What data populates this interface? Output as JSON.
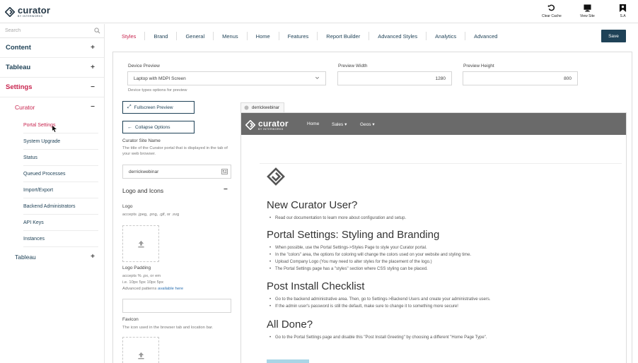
{
  "header": {
    "brand_name": "curator",
    "brand_sub": "BY INTERWORKS",
    "actions": [
      {
        "label": "Clear Cache",
        "icon": "refresh-icon"
      },
      {
        "label": "View Site",
        "icon": "monitor-icon"
      },
      {
        "label": "S.A",
        "icon": "user-flag-icon"
      }
    ]
  },
  "sidebar": {
    "search_placeholder": "Search",
    "items": [
      {
        "label": "Content",
        "toggle": "+"
      },
      {
        "label": "Tableau",
        "toggle": "+"
      },
      {
        "label": "Settings",
        "toggle": "−"
      }
    ],
    "curator": {
      "label": "Curator",
      "toggle": "−"
    },
    "leaves": [
      "Portal Settings",
      "System Upgrade",
      "Status",
      "Queued Processes",
      "Import/Export",
      "Backend Administrators",
      "API Keys",
      "Instances"
    ],
    "tableau_sub": {
      "label": "Tableau",
      "toggle": "+"
    }
  },
  "tabs": [
    "Styles",
    "Brand",
    "General",
    "Menus",
    "Home",
    "Features",
    "Report Builder",
    "Advanced Styles",
    "Analytics",
    "Advanced"
  ],
  "save_label": "Save",
  "form": {
    "device_preview_label": "Device Preview",
    "device_preview_value": "Laptop with MDPI Screen",
    "device_preview_hint": "Device types options for preview",
    "preview_width_label": "Preview Width",
    "preview_width_value": "1280",
    "preview_height_label": "Preview Height",
    "preview_height_value": "800",
    "fullscreen_label": "Fullscreen Preview",
    "collapse_label": "Collapse Options",
    "site_name_label": "Curator Site Name",
    "site_name_hint": "The title of the Curator portal that is displayed in the tab of your web browser.",
    "site_name_value": "derrickwebinar",
    "logo_section": "Logo and Icons",
    "logo_section_toggle": "−",
    "logo_label": "Logo",
    "logo_hint": "accepts .jpeg, .png, .gif, or .svg",
    "logo_padding_label": "Logo Padding",
    "logo_padding_hint_1": "accepts % ,px, or em",
    "logo_padding_hint_2": "i.e. 10px 5px 10px 5px",
    "logo_padding_hint_3": "Advanced patterns",
    "logo_padding_link": "available here",
    "favicon_label": "Favicon",
    "favicon_hint": "The icon used in the browser tab and location bar."
  },
  "preview": {
    "tab_label": "derrickwebinar",
    "nav": [
      "Home",
      "Sales ▾",
      "Geos ▾"
    ],
    "h1": "New Curator User?",
    "h1_li": "Read our documentation to learn more about configuration and setup.",
    "h2": "Portal Settings: Styling and Branding",
    "h2_li": [
      "When possible, use the Portal Settings->Styles Page to style your Curator portal.",
      "In the \"colors\" area, the options for coloring will change the colors used on your website and styling time.",
      "Upload Company Logo (You may need to alter styles for the placement of the logo.)",
      "The Portal Settings page has a \"styles\" section where CSS styling can be placed."
    ],
    "h3": "Post Install Checklist",
    "h3_li": [
      "Go to the backend administrative area. Then, go to Settings->Backend Users and create your administrative users.",
      "If the admin user's password is still the default, make sure to change it to something more secure!"
    ],
    "h4": "All Done?",
    "h4_li": "Go to the Portal Settings page and disable this \"Post Install Greeting\" by choosing a different \"Home Page Type\"."
  },
  "colors": {
    "accent": "#c8254f",
    "navy": "#1f4257",
    "preview_nav": "#6a6a6a"
  }
}
